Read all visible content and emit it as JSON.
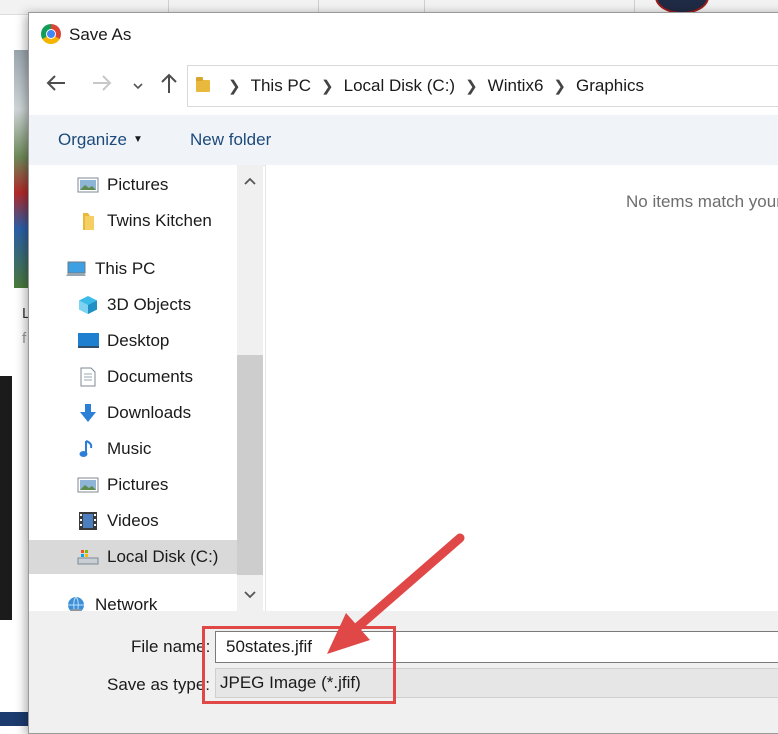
{
  "dialog": {
    "title": "Save As"
  },
  "navigation": {
    "back_icon": "back-arrow-icon",
    "forward_icon": "forward-arrow-icon",
    "recent_icon": "chevron-down-icon",
    "up_icon": "up-arrow-icon",
    "breadcrumbs": [
      "This PC",
      "Local Disk (C:)",
      "Wintix6",
      "Graphics"
    ]
  },
  "toolbar": {
    "organize_label": "Organize",
    "new_folder_label": "New folder"
  },
  "sidebar": {
    "items": [
      {
        "label": "Pictures",
        "icon": "pictures-icon"
      },
      {
        "label": "Twins Kitchen",
        "icon": "folder-icon"
      },
      {
        "label": "This PC",
        "icon": "computer-icon"
      },
      {
        "label": "3D Objects",
        "icon": "3d-objects-icon"
      },
      {
        "label": "Desktop",
        "icon": "desktop-icon"
      },
      {
        "label": "Documents",
        "icon": "documents-icon"
      },
      {
        "label": "Downloads",
        "icon": "downloads-icon"
      },
      {
        "label": "Music",
        "icon": "music-icon"
      },
      {
        "label": "Pictures",
        "icon": "pictures-icon"
      },
      {
        "label": "Videos",
        "icon": "videos-icon"
      },
      {
        "label": "Local Disk (C:)",
        "icon": "drive-icon",
        "selected": true
      },
      {
        "label": "Network",
        "icon": "network-icon"
      }
    ]
  },
  "content": {
    "empty_message": "No items match your search."
  },
  "form": {
    "file_name_label": "File name:",
    "file_name_value": "50states.jfif",
    "save_as_type_label": "Save as type:",
    "save_as_type_value": "JPEG Image (*.jfif)"
  },
  "annotation": {
    "color": "#e04848"
  },
  "background": {
    "text_line1": "L",
    "text_line2": "f"
  }
}
